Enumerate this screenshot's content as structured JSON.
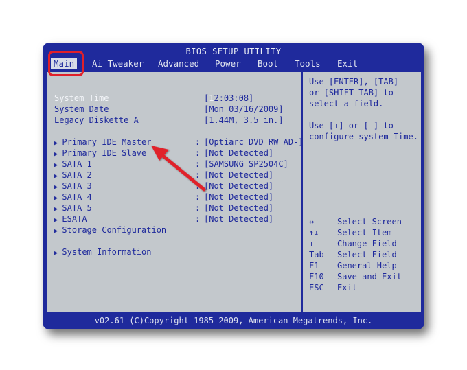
{
  "title": "BIOS SETUP UTILITY",
  "menu": [
    "Main",
    "Ai Tweaker",
    "Advanced",
    "Power",
    "Boot",
    "Tools",
    "Exit"
  ],
  "main": {
    "system_time_label": "System Time",
    "system_time_cursor": "1",
    "system_time_value": "2:03:08]",
    "system_time_open": "[",
    "system_date_label": "System Date",
    "system_date_value": "[Mon 03/16/2009]",
    "legacy_label": "Legacy Diskette A",
    "legacy_value": "[1.44M, 3.5 in.]",
    "devices": [
      {
        "label": "Primary IDE Master",
        "value": "[Optiarc DVD RW AD-]"
      },
      {
        "label": "Primary IDE Slave",
        "value": "[Not Detected]"
      },
      {
        "label": "SATA 1",
        "value": "[SAMSUNG SP2504C]"
      },
      {
        "label": "SATA 2",
        "value": "[Not Detected]"
      },
      {
        "label": "SATA 3",
        "value": "[Not Detected]"
      },
      {
        "label": "SATA 4",
        "value": "[Not Detected]"
      },
      {
        "label": "SATA 5",
        "value": "[Not Detected]"
      },
      {
        "label": "ESATA",
        "value": "[Not Detected]"
      }
    ],
    "storage_config": "Storage Configuration",
    "system_info": "System Information",
    "submenu_arrow": "▶",
    "separator": ":"
  },
  "help": {
    "lines1": [
      "Use [ENTER], [TAB]",
      "or [SHIFT-TAB] to",
      "select a field."
    ],
    "lines2": [
      "Use [+] or [-] to",
      "configure system Time."
    ],
    "keys": [
      {
        "key": "↔",
        "desc": "Select Screen"
      },
      {
        "key": "↑↓",
        "desc": "Select Item"
      },
      {
        "key": "+-",
        "desc": "Change Field"
      },
      {
        "key": "Tab",
        "desc": "Select Field"
      },
      {
        "key": "F1",
        "desc": "General Help"
      },
      {
        "key": "F10",
        "desc": "Save and Exit"
      },
      {
        "key": "ESC",
        "desc": "Exit"
      }
    ]
  },
  "footer": "v02.61 (C)Copyright 1985-2009, American Megatrends, Inc.",
  "colors": {
    "bios_blue": "#1f2a9c",
    "panel_gray": "#c3c8cc",
    "highlight_white": "#f2f4f8",
    "annotation_red": "#e0202a"
  }
}
